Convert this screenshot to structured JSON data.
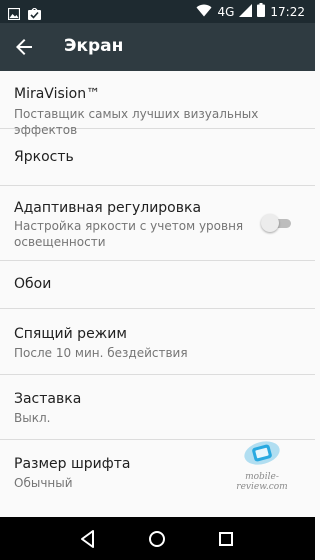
{
  "status_bar": {
    "network": "4G",
    "time": "17:22",
    "icons": [
      "image-notification-icon",
      "check-notification-icon",
      "wifi-icon",
      "signal-icon",
      "battery-icon"
    ]
  },
  "app_bar": {
    "title": "Экран",
    "back_icon": "arrow-left-icon",
    "background": "#2f3b41"
  },
  "settings": {
    "miravision": {
      "title": "MiraVision™",
      "subtitle": "Поставщик самых лучших визуальных эффектов"
    },
    "brightness": {
      "title": "Яркость"
    },
    "adaptive": {
      "title": "Адаптивная регулировка",
      "subtitle_line1": "Настройка яркости с учетом уровня",
      "subtitle_line2": "освещенности",
      "enabled": false
    },
    "wallpaper": {
      "title": "Обои"
    },
    "sleep": {
      "title": "Спящий режим",
      "subtitle": "После 10 мин. бездействия"
    },
    "screensaver": {
      "title": "Заставка",
      "subtitle": "Выкл."
    },
    "font_size": {
      "title": "Размер шрифта",
      "subtitle": "Обычный"
    }
  },
  "watermark": {
    "text": "mobile-review.com",
    "accent": "#29a9e0"
  },
  "nav_bar": {
    "icons": [
      "back-triangle-icon",
      "home-circle-icon",
      "recents-square-icon"
    ]
  }
}
